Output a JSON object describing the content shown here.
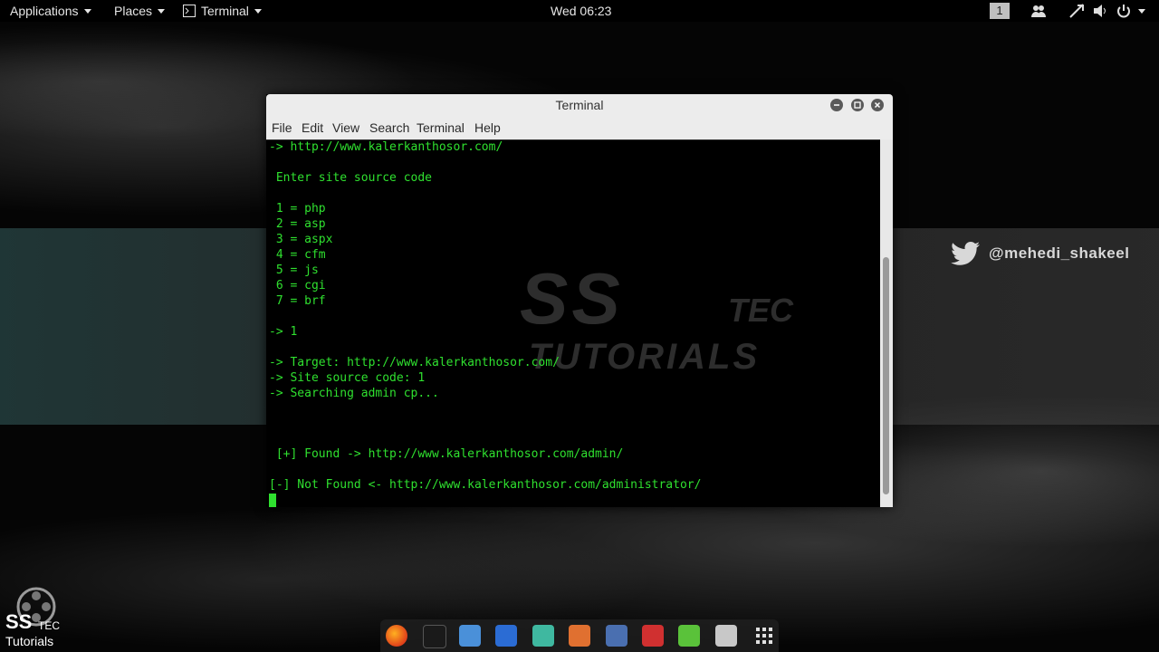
{
  "topbar": {
    "applications": "Applications",
    "places": "Places",
    "terminal": "Terminal",
    "clock": "Wed 06:23",
    "workspace": "1"
  },
  "desktop": {
    "twitter_handle": "@mehedi_shakeel",
    "logo": {
      "ss": "SS",
      "tec": "TEC",
      "tutorials": "Tutorials"
    }
  },
  "window": {
    "title": "Terminal",
    "menu": [
      "File",
      "Edit",
      "View",
      "Search",
      "Terminal",
      "Help"
    ],
    "lines": [
      "-> http://www.kalerkanthosor.com/",
      "",
      " Enter site source code",
      "",
      " 1 = php",
      " 2 = asp",
      " 3 = aspx",
      " 4 = cfm",
      " 5 = js",
      " 6 = cgi",
      " 7 = brf",
      "",
      "-> 1",
      "",
      "-> Target: http://www.kalerkanthosor.com/",
      "-> Site source code: 1",
      "-> Searching admin cp...",
      "",
      "",
      " [+] Found -> http://www.kalerkanthosor.com/admin/",
      "",
      "[-] Not Found <- http://www.kalerkanthosor.com/administrator/"
    ],
    "watermark": {
      "ss": "SS",
      "tec": "TEC",
      "tutorials": "TUTORIALS"
    }
  },
  "colors": {
    "terminal_text": "#2fe02f",
    "titlebar": "#ececec"
  },
  "dock_icons": [
    "firefox-icon",
    "terminal-icon",
    "files-icon",
    "metasploit-icon",
    "armitage-icon",
    "burpsuite-icon",
    "maltego-icon",
    "faraday-icon",
    "leafpad-icon",
    "cherrytree-icon",
    "apps-grid-icon"
  ]
}
